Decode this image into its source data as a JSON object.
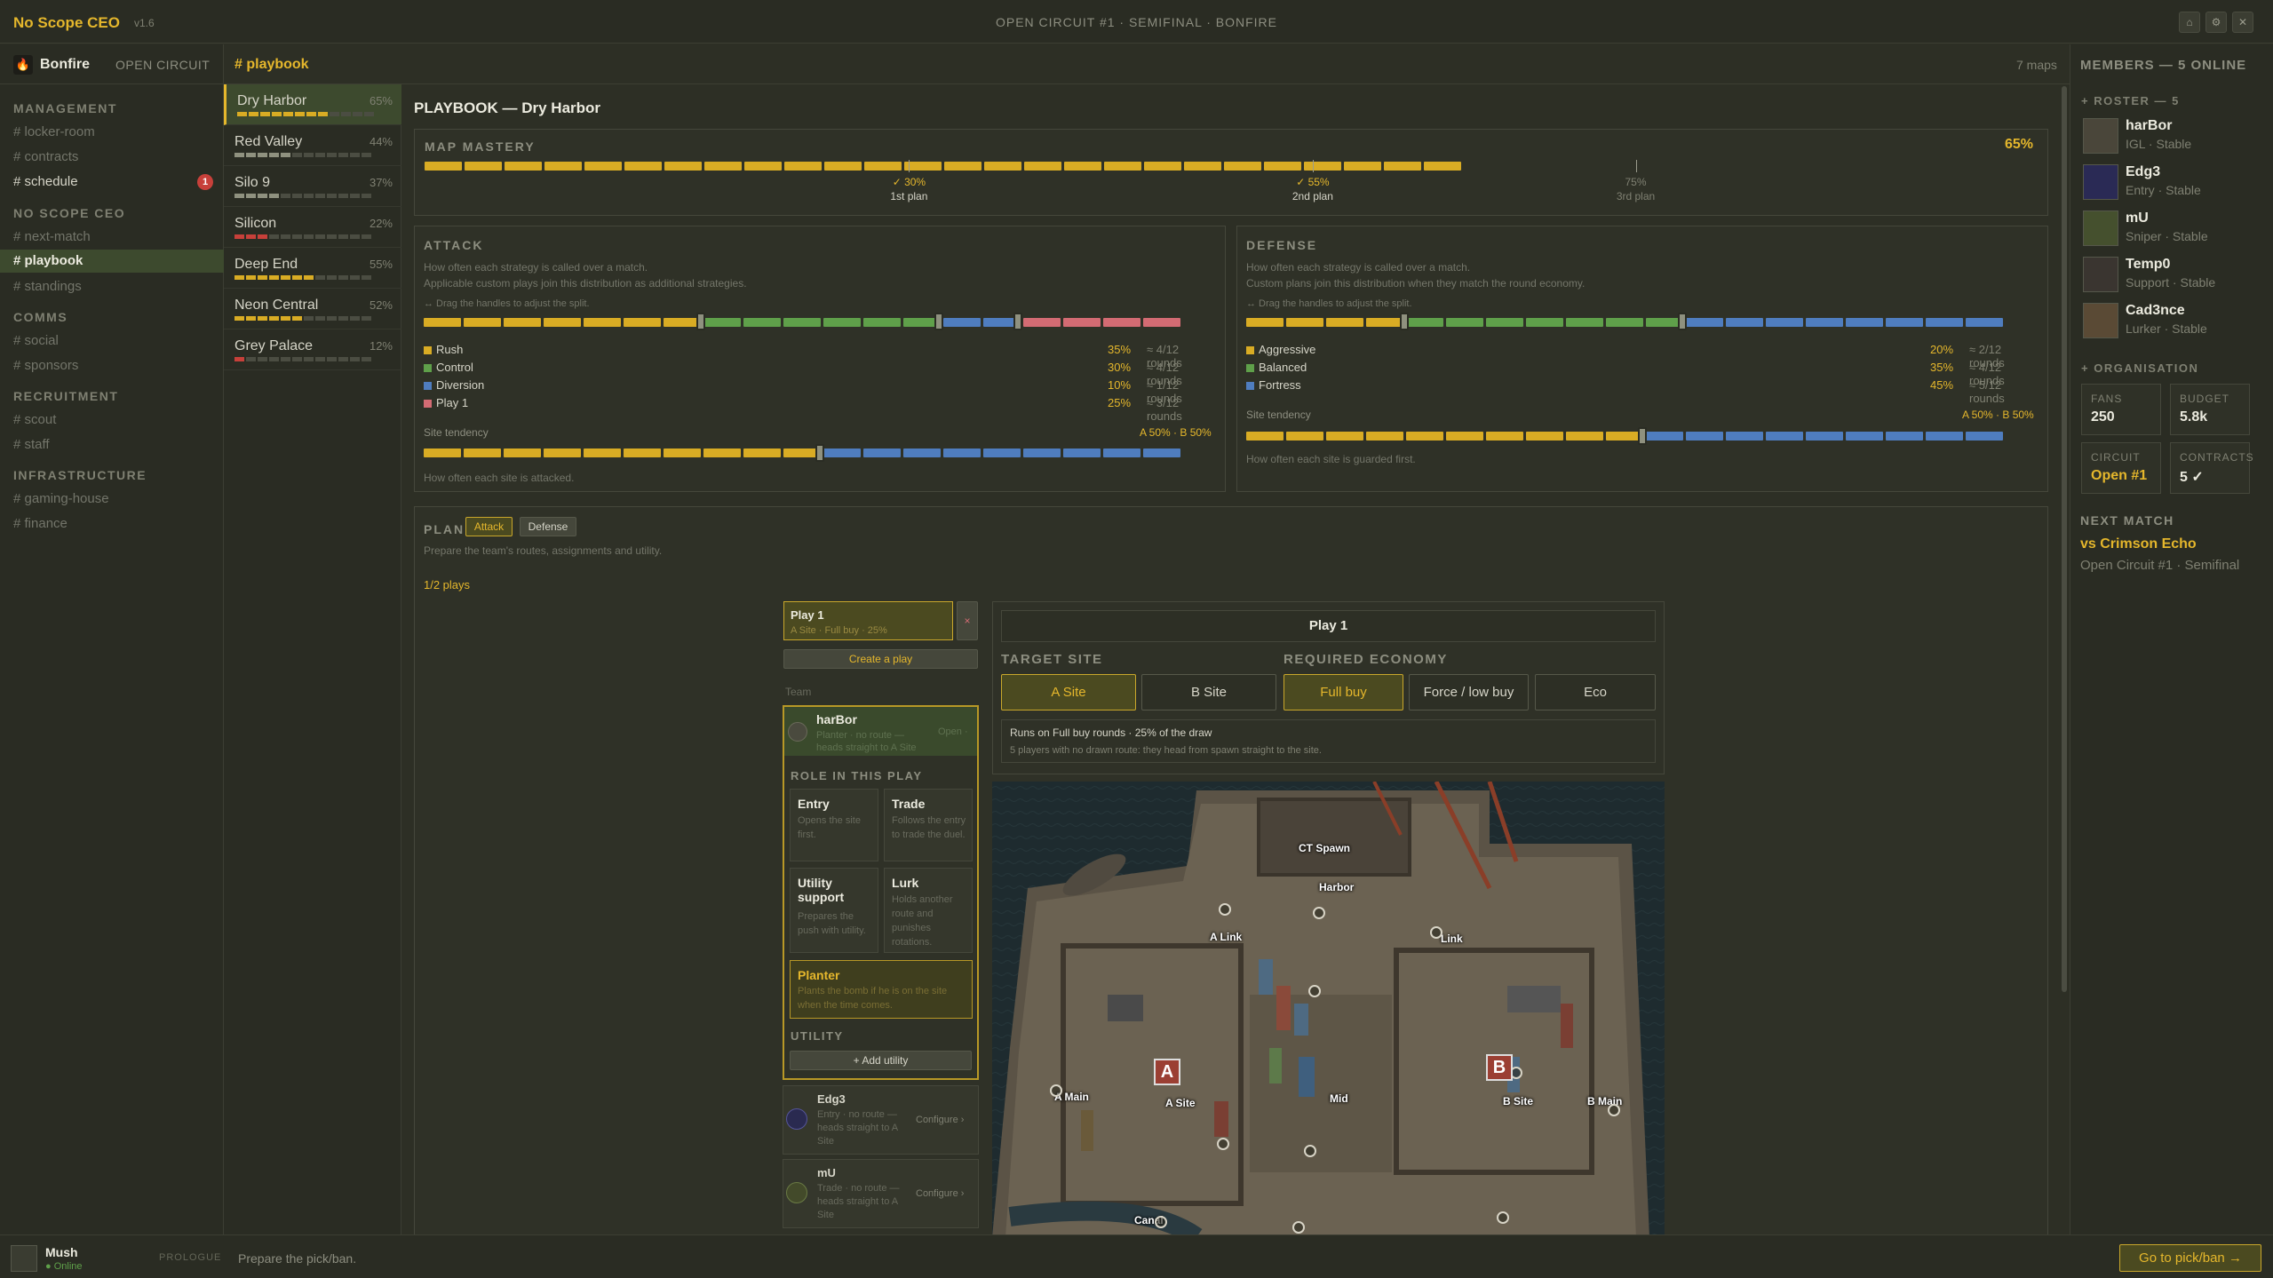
{
  "window": {
    "app_title": "No Scope CEO",
    "version": "v1.6",
    "match_title": "OPEN CIRCUIT #1 · SEMIFINAL · BONFIRE",
    "buttons": [
      "⌂",
      "⚙",
      "✕"
    ]
  },
  "server": {
    "name": "Bonfire",
    "tag": "OPEN CIRCUIT",
    "categories": [
      {
        "title": "MANAGEMENT",
        "channels": [
          "# locker-room",
          "# contracts",
          "# schedule"
        ]
      },
      {
        "title": "NO SCOPE CEO",
        "channels": [
          "# next-match",
          "# playbook",
          "# standings"
        ]
      },
      {
        "title": "COMMS",
        "channels": [
          "# social",
          "# sponsors"
        ]
      },
      {
        "title": "RECRUITMENT",
        "channels": [
          "# scout",
          "# staff"
        ]
      },
      {
        "title": "INFRASTRUCTURE",
        "channels": [
          "# gaming-house",
          "# finance"
        ]
      }
    ],
    "schedule_badge": "1"
  },
  "channel": {
    "name": "# playbook",
    "maps_count": "7 maps"
  },
  "maps": [
    {
      "name": "Dry Harbor",
      "pct": "65%",
      "level": 0.65
    },
    {
      "name": "Red Valley",
      "pct": "44%",
      "level": 0.44
    },
    {
      "name": "Silo 9",
      "pct": "37%",
      "level": 0.37
    },
    {
      "name": "Silicon",
      "pct": "22%",
      "level": 0.22
    },
    {
      "name": "Deep End",
      "pct": "55%",
      "level": 0.55
    },
    {
      "name": "Neon Central",
      "pct": "52%",
      "level": 0.52
    },
    {
      "name": "Grey Palace",
      "pct": "12%",
      "level": 0.12
    }
  ],
  "playbook": {
    "title": "PLAYBOOK — Dry Harbor",
    "mastery": {
      "label": "MAP MASTERY",
      "value": "65%",
      "level": 0.65,
      "markers": [
        {
          "pct": "✓ 30%",
          "label": "1st plan"
        },
        {
          "pct": "✓ 55%",
          "label": "2nd plan"
        },
        {
          "pct": "75%",
          "label": "3rd plan"
        }
      ]
    },
    "attack": {
      "title": "ATTACK",
      "help1": "How often each strategy is called over a match.",
      "help2": "Applicable custom plays join this distribution as additional strategies.",
      "help3": "↔ Drag the handles to adjust the split.",
      "items": [
        {
          "label": "Rush",
          "pct": "35%",
          "rounds": "≈ 4/12 rounds",
          "color": "#d9ac24"
        },
        {
          "label": "Control",
          "pct": "30%",
          "rounds": "≈ 4/12 rounds",
          "color": "#5fa04a"
        },
        {
          "label": "Diversion",
          "pct": "10%",
          "rounds": "≈ 1/12 rounds",
          "color": "#4f7dbf"
        },
        {
          "label": "Play 1",
          "pct": "25%",
          "rounds": "≈ 3/12 rounds",
          "color": "#d36b73"
        }
      ],
      "site_label": "Site tendency",
      "site_value": "A 50% · B 50%",
      "site_help": "How often each site is attacked."
    },
    "defense": {
      "title": "DEFENSE",
      "help1": "How often each strategy is called over a match.",
      "help2": "Custom plans join this distribution when they match the round economy.",
      "help3": "↔ Drag the handles to adjust the split.",
      "items": [
        {
          "label": "Aggressive",
          "pct": "20%",
          "rounds": "≈ 2/12 rounds",
          "color": "#d9ac24"
        },
        {
          "label": "Balanced",
          "pct": "35%",
          "rounds": "≈ 4/12 rounds",
          "color": "#5fa04a"
        },
        {
          "label": "Fortress",
          "pct": "45%",
          "rounds": "≈ 5/12 rounds",
          "color": "#4f7dbf"
        }
      ],
      "site_label": "Site tendency",
      "site_value": "A 50% · B 50%",
      "site_help": "How often each site is guarded first."
    },
    "plan": {
      "title": "PLAN",
      "tab_attack": "Attack",
      "tab_defense": "Defense",
      "help": "Prepare the team's routes, assignments and utility.",
      "plays_count": "1/2 plays",
      "play_name": "Play 1",
      "play_sub": "A Site · Full buy · 25%",
      "delete": "×",
      "create": "Create a play",
      "team_label": "Team",
      "selected_player": {
        "name": "harBor",
        "desc": "Planter · no route — heads straight to A Site",
        "action": "Open ·"
      },
      "role_title": "ROLE IN THIS PLAY",
      "roles": [
        {
          "name": "Entry",
          "desc": "Opens the site first."
        },
        {
          "name": "Trade",
          "desc": "Follows the entry to trade the duel."
        },
        {
          "name": "Utility support",
          "desc": "Prepares the push with utility."
        },
        {
          "name": "Lurk",
          "desc": "Holds another route and punishes rotations."
        },
        {
          "name": "Planter",
          "desc": "Plants the bomb if he is on the site when the time comes."
        }
      ],
      "utility_title": "UTILITY",
      "add_utility": "+ Add utility",
      "other_players": [
        {
          "name": "Edg3",
          "desc": "Entry · no route — heads straight to A Site",
          "action": "Configure ›"
        },
        {
          "name": "mU",
          "desc": "Trade · no route — heads straight to A Site",
          "action": "Configure ›"
        }
      ],
      "editor": {
        "play_title": "Play 1",
        "target_site_label": "TARGET SITE",
        "sites": [
          "A Site",
          "B Site"
        ],
        "economy_label": "REQUIRED ECONOMY",
        "economy": [
          "Full buy",
          "Force / low buy",
          "Eco"
        ],
        "info1": "Runs on Full buy rounds · 25% of the draw",
        "info2": "5 players with no drawn route: they head from spawn straight to the site."
      },
      "map_labels": [
        "CT Spawn",
        "Harbor",
        "A Link",
        "Link",
        "A Main",
        "A Site",
        "Mid",
        "B Site",
        "B Main",
        "Canal"
      ]
    }
  },
  "members": {
    "header": "MEMBERS — 5 ONLINE",
    "roster_title": "+ ROSTER — 5",
    "roster": [
      {
        "name": "harBor",
        "role": "IGL · Stable"
      },
      {
        "name": "Edg3",
        "role": "Entry · Stable"
      },
      {
        "name": "mU",
        "role": "Sniper · Stable"
      },
      {
        "name": "Temp0",
        "role": "Support · Stable"
      },
      {
        "name": "Cad3nce",
        "role": "Lurker · Stable"
      }
    ],
    "org_title": "+ ORGANISATION",
    "stats": [
      {
        "label": "FANS",
        "value": "250"
      },
      {
        "label": "BUDGET",
        "value": "5.8k"
      },
      {
        "label": "CIRCUIT",
        "value": "Open #1"
      },
      {
        "label": "CONTRACTS",
        "value": "5 ✓"
      }
    ],
    "next_title": "NEXT MATCH",
    "next_opponent": "vs Crimson Echo",
    "next_event": "Open Circuit #1 · Semifinal"
  },
  "footer": {
    "user": "Mush",
    "status": "● Online",
    "phase": "PROLOGUE",
    "hint": "Prepare the pick/ban.",
    "cta": "Go to pick/ban →"
  },
  "colors": {
    "accent": "#e5b72c",
    "attack_rush": "#d9ac24",
    "control": "#5fa04a",
    "diversion": "#4f7dbf",
    "play": "#d36b73"
  }
}
